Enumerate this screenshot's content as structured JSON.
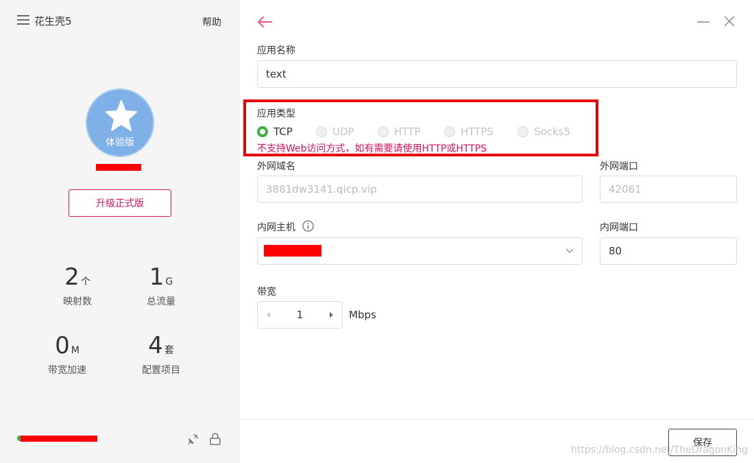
{
  "app": {
    "title": "花生壳5",
    "help": "帮助"
  },
  "profile": {
    "badge": "体验版",
    "upgrade_label": "升级正式版"
  },
  "stats": [
    {
      "value": "2",
      "unit": "个",
      "label": "映射数"
    },
    {
      "value": "1",
      "unit": "G",
      "label": "总流量"
    },
    {
      "value": "0",
      "unit": "M",
      "label": "带宽加速"
    },
    {
      "value": "4",
      "unit": "套",
      "label": "配置项目"
    }
  ],
  "form": {
    "app_name": {
      "label": "应用名称",
      "value": "text"
    },
    "app_type": {
      "label": "应用类型",
      "options": [
        {
          "label": "TCP",
          "selected": true
        },
        {
          "label": "UDP",
          "selected": false
        },
        {
          "label": "HTTP",
          "selected": false
        },
        {
          "label": "HTTPS",
          "selected": false
        },
        {
          "label": "Socks5",
          "selected": false
        }
      ],
      "warning": "不支持Web访问方式，如有需要请使用HTTP或HTTPS"
    },
    "external_domain": {
      "label": "外网域名",
      "value": "3881dw3141.qicp.vip"
    },
    "external_port": {
      "label": "外网端口",
      "value": "42061"
    },
    "internal_host": {
      "label": "内网主机",
      "value": ""
    },
    "internal_port": {
      "label": "内网端口",
      "value": "80"
    },
    "bandwidth": {
      "label": "带宽",
      "value": "1",
      "unit": "Mbps"
    }
  },
  "footer": {
    "save_label": "保存",
    "watermark": "https://blog.csdn.net/TheDragonKing"
  },
  "icons": {
    "menu": "hamburger-menu-icon",
    "star": "star-icon",
    "back": "arrow-left-icon",
    "minimize": "minimize-icon",
    "close": "close-icon",
    "info": "info-icon",
    "dropdown": "chevron-down-icon",
    "satellite": "satellite-icon",
    "lock": "lock-icon"
  },
  "colors": {
    "accent": "#d4145a",
    "radio_selected": "#3cb13c",
    "avatar": "#7fb0e8",
    "redact": "#ff0000",
    "highlight_box": "#e60000"
  }
}
